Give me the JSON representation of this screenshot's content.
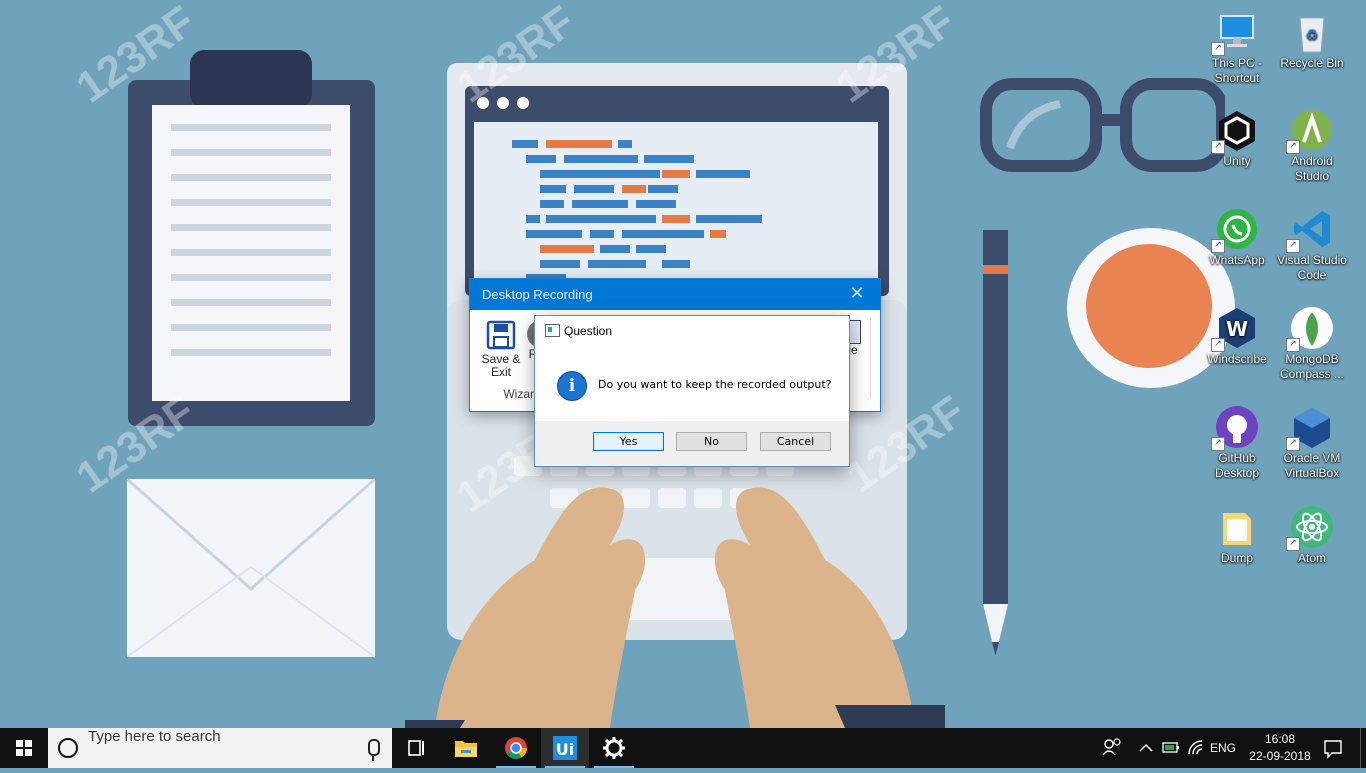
{
  "desktop": {
    "icons": [
      {
        "label": "This PC - Shortcut",
        "icon": "this-pc-icon"
      },
      {
        "label": "Recycle Bin",
        "icon": "recycle-bin-icon"
      },
      {
        "label": "Unity",
        "icon": "unity-icon"
      },
      {
        "label": "Android Studio",
        "icon": "android-studio-icon"
      },
      {
        "label": "WhatsApp",
        "icon": "whatsapp-icon"
      },
      {
        "label": "Visual Studio Code",
        "icon": "vscode-icon"
      },
      {
        "label": "Windscribe",
        "icon": "windscribe-icon"
      },
      {
        "label": "MongoDB Compass ...",
        "icon": "mongodb-icon"
      },
      {
        "label": "GitHub Desktop",
        "icon": "github-icon"
      },
      {
        "label": "Oracle VM VirtualBox",
        "icon": "virtualbox-icon"
      },
      {
        "label": "Dump",
        "icon": "folder-icon"
      },
      {
        "label": "Atom",
        "icon": "atom-icon"
      }
    ],
    "wallpaper_watermark": "123RF"
  },
  "recording_window": {
    "title": "Desktop Recording",
    "tools": {
      "save_exit": "Save & Exit",
      "partial_r": "R",
      "partial_ge": "ge",
      "group_label": "Wizard"
    }
  },
  "question_dialog": {
    "title": "Question",
    "message": "Do you want to keep the recorded output?",
    "buttons": {
      "yes": "Yes",
      "no": "No",
      "cancel": "Cancel"
    }
  },
  "taskbar": {
    "search_placeholder": "Type here to search",
    "language": "ENG",
    "time": "16:08",
    "date": "22-09-2018"
  },
  "colors": {
    "desktop_bg": "#6fa3bb",
    "accent": "#0078d7",
    "taskbar": "#101010"
  }
}
